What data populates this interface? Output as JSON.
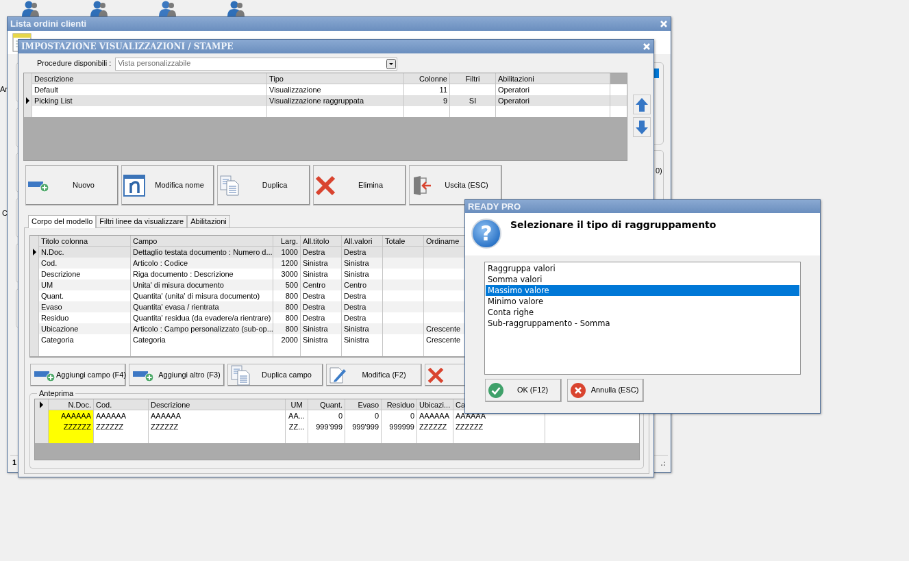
{
  "back_window": {
    "title": "Lista ordini clienti",
    "fragments": [
      {
        "text": "Ar",
        "kind": "left_top"
      },
      {
        "text": "C",
        "kind": "left_bottom"
      },
      {
        "text": "0)",
        "kind": "right"
      },
      {
        "text": "1",
        "kind": "status"
      }
    ]
  },
  "dialog": {
    "title": "IMPOSTAZIONE VISUALIZZAZIONI / STAMPE",
    "procedure": {
      "label": "Procedure disponibili :",
      "value": "Vista personalizzabile"
    },
    "views": {
      "columns": [
        {
          "label": "Descrizione"
        },
        {
          "label": "Tipo"
        },
        {
          "label": "Colonne"
        },
        {
          "label": "Filtri"
        },
        {
          "label": "Abilitazioni"
        }
      ],
      "rows": [
        {
          "cells": [
            "Default",
            "Visualizzazione",
            "11",
            "",
            "Operatori"
          ],
          "selected": false
        },
        {
          "cells": [
            "Picking List",
            "Visualizzazione raggruppata",
            "9",
            "SI",
            "Operatori"
          ],
          "selected": true
        }
      ]
    },
    "buttons": [
      {
        "label": "Nuovo",
        "kind": "new"
      },
      {
        "label": "Modifica nome",
        "kind": "rename"
      },
      {
        "label": "Duplica",
        "kind": "duplicate"
      },
      {
        "label": "Elimina",
        "kind": "delete"
      },
      {
        "label": "Uscita (ESC)",
        "kind": "exit"
      }
    ],
    "tabs": [
      {
        "label": "Corpo del modello",
        "selected": true
      },
      {
        "label": "Filtri linee da visualizzare",
        "selected": false
      },
      {
        "label": "Abilitazioni",
        "selected": false
      }
    ],
    "fields": {
      "columns": [
        {
          "label": "Titolo colonna"
        },
        {
          "label": "Campo"
        },
        {
          "label": "Larg."
        },
        {
          "label": "All.titolo"
        },
        {
          "label": "All.valori"
        },
        {
          "label": "Totale"
        },
        {
          "label": "Ordiname"
        }
      ],
      "rows": [
        {
          "cells": [
            "N.Doc.",
            "Dettaglio testata documento : Numero d...",
            "1000",
            "Destra",
            "Destra",
            "",
            ""
          ],
          "selected": true
        },
        {
          "cells": [
            "Cod.",
            "Articolo : Codice",
            "1200",
            "Sinistra",
            "Sinistra",
            "",
            ""
          ],
          "selected": false
        },
        {
          "cells": [
            "Descrizione",
            "Riga documento : Descrizione",
            "3000",
            "Sinistra",
            "Sinistra",
            "",
            ""
          ],
          "selected": false
        },
        {
          "cells": [
            "UM",
            "Unita' di misura documento",
            "500",
            "Centro",
            "Centro",
            "",
            ""
          ],
          "selected": false
        },
        {
          "cells": [
            "Quant.",
            "Quantita' (unita' di misura documento)",
            "800",
            "Destra",
            "Destra",
            "",
            ""
          ],
          "selected": false
        },
        {
          "cells": [
            "Evaso",
            "Quantita' evasa / rientrata",
            "800",
            "Destra",
            "Destra",
            "",
            ""
          ],
          "selected": false
        },
        {
          "cells": [
            "Residuo",
            "Quantita' residua (da evadere/a rientrare)",
            "800",
            "Destra",
            "Destra",
            "",
            ""
          ],
          "selected": false
        },
        {
          "cells": [
            "Ubicazione",
            "Articolo : Campo personalizzato (sub-op...",
            "800",
            "Sinistra",
            "Sinistra",
            "",
            "Crescente"
          ],
          "selected": false
        },
        {
          "cells": [
            "Categoria",
            "Categoria",
            "2000",
            "Sinistra",
            "Sinistra",
            "",
            "Crescente"
          ],
          "selected": false
        }
      ]
    },
    "field_buttons": [
      {
        "label": "Aggiungi campo (F4)",
        "kind": "new"
      },
      {
        "label": "Aggiungi altro (F3)",
        "kind": "new"
      },
      {
        "label": "Duplica campo",
        "kind": "duplicate"
      },
      {
        "label": "Modifica (F2)",
        "kind": "edit"
      },
      {
        "kind": "delete"
      }
    ],
    "preview": {
      "title": "Anteprima",
      "columns": [
        {
          "label": "N.Doc.",
          "color": "#ffff00"
        },
        {
          "label": "Cod."
        },
        {
          "label": "Descrizione"
        },
        {
          "label": "UM"
        },
        {
          "label": "Quant."
        },
        {
          "label": "Evaso"
        },
        {
          "label": "Residuo"
        },
        {
          "label": "Ubicazi..."
        },
        {
          "label": "Ca"
        }
      ],
      "rows": [
        {
          "cells": [
            "AAAAAA",
            "AAAAAA",
            "AAAAAA",
            "AA...",
            "0",
            "0",
            "0",
            "AAAAAA",
            "AAAAAA"
          ]
        },
        {
          "cells": [
            "ZZZZZZ",
            "ZZZZZZ",
            "ZZZZZZ",
            "ZZ...",
            "999'999",
            "999'999",
            "999999",
            "ZZZZZZ",
            "ZZZZZZ"
          ]
        }
      ]
    }
  },
  "prompt": {
    "title": "READY PRO",
    "icon": "?",
    "message": "Selezionare il tipo di raggruppamento",
    "options": [
      {
        "label": "Raggruppa valori",
        "selected": false
      },
      {
        "label": "Somma valori",
        "selected": false
      },
      {
        "label": "Massimo valore",
        "selected": true
      },
      {
        "label": "Minimo valore",
        "selected": false
      },
      {
        "label": "Conta righe",
        "selected": false
      },
      {
        "label": "Sub-raggruppamento - Somma",
        "selected": false
      }
    ],
    "buttons": [
      {
        "label": "OK (F12)",
        "kind": "ok"
      },
      {
        "label": "Annulla (ESC)",
        "kind": "cancel"
      }
    ]
  }
}
